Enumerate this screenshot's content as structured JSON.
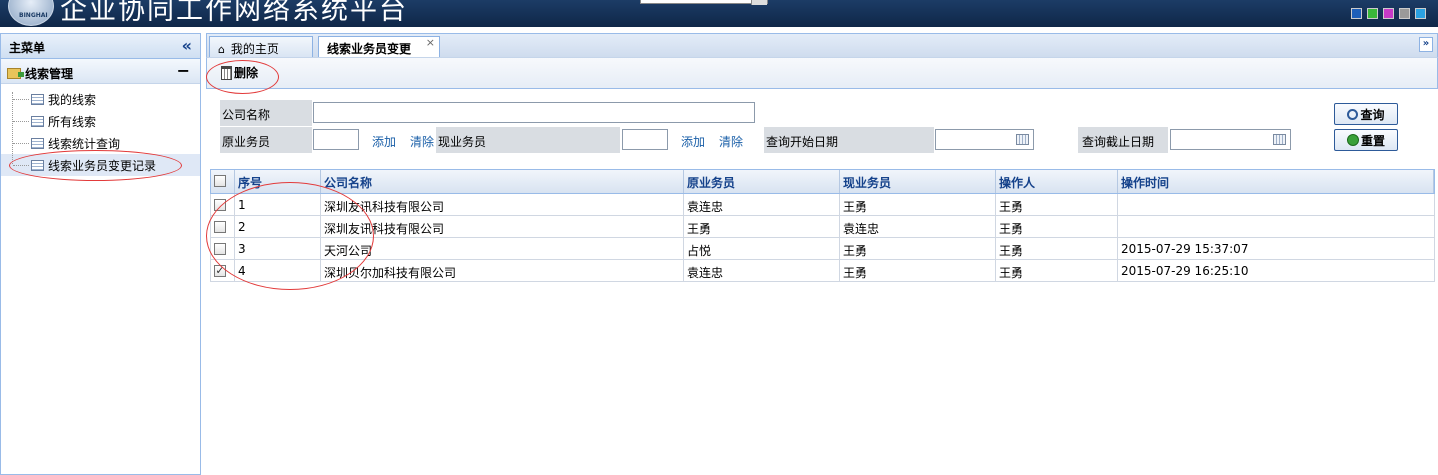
{
  "header": {
    "title": "企业协同工作网络系统平台",
    "logo_text": "BINGHAI",
    "theme_colors": [
      "#1e5fb8",
      "#3ab83a",
      "#c83ac8",
      "#9a9a9a",
      "#2aa0e0"
    ]
  },
  "sidebar": {
    "title": "主菜单",
    "collapse_icon": "double-chevron-left-icon",
    "group": {
      "label": "线索管理",
      "toggle": "−"
    },
    "items": [
      {
        "label": "我的线索"
      },
      {
        "label": "所有线索"
      },
      {
        "label": "线索统计查询"
      },
      {
        "label": "线索业务员变更记录"
      }
    ]
  },
  "tabs": {
    "home": "我的主页",
    "active": "线索业务员变更",
    "close": "×",
    "menu": "»"
  },
  "toolbar": {
    "delete_label": "删除"
  },
  "search": {
    "company_label": "公司名称",
    "company_value": "",
    "orig_rep_label": "原业务员",
    "orig_rep_value": "",
    "cur_rep_label": "现业务员",
    "cur_rep_value": "",
    "add_label": "添加",
    "clear_label": "清除",
    "start_date_label": "查询开始日期",
    "start_date_value": "",
    "end_date_label": "查询截止日期",
    "end_date_value": "",
    "query_button": "查询",
    "reset_button": "重置"
  },
  "grid": {
    "columns": [
      "序号",
      "公司名称",
      "原业务员",
      "现业务员",
      "操作人",
      "操作时间"
    ],
    "rows": [
      {
        "checked": false,
        "no": "1",
        "company": "深圳友讯科技有限公司",
        "orig": "袁连忠",
        "cur": "王勇",
        "operator": "王勇",
        "time": ""
      },
      {
        "checked": false,
        "no": "2",
        "company": "深圳友讯科技有限公司",
        "orig": "王勇",
        "cur": "袁连忠",
        "operator": "王勇",
        "time": ""
      },
      {
        "checked": false,
        "no": "3",
        "company": "天河公司",
        "orig": "占悦",
        "cur": "王勇",
        "operator": "王勇",
        "time": "2015-07-29 15:37:07"
      },
      {
        "checked": true,
        "no": "4",
        "company": "深圳贝尔加科技有限公司",
        "orig": "袁连忠",
        "cur": "王勇",
        "operator": "王勇",
        "time": "2015-07-29 16:25:10"
      }
    ]
  },
  "annotation_color": "#e23a3a"
}
